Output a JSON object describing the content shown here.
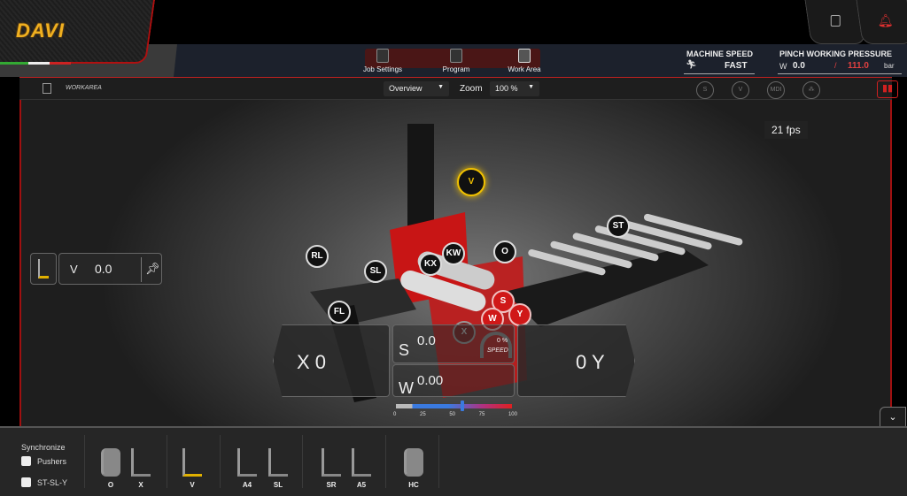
{
  "brand": {
    "logo": "DAVI"
  },
  "nav": {
    "tabs": [
      {
        "label": "Job Settings"
      },
      {
        "label": "Program"
      },
      {
        "label": "Work Area"
      }
    ],
    "active": "Work Area"
  },
  "status": {
    "machine_speed": {
      "label": "MACHINE SPEED",
      "value": "FAST"
    },
    "pinch_pressure": {
      "label": "PINCH WORKING PRESSURE",
      "axis": "W",
      "current": "0.0",
      "sep": "/",
      "setpoint": "111.0",
      "unit": "bar"
    }
  },
  "toolbar": {
    "title": "WORKAREA",
    "view": "Overview",
    "zoom_label": "Zoom",
    "zoom": "100 %",
    "icons": [
      "s-axis-icon",
      "v-axis-icon",
      "mdi-icon",
      "cluster-icon",
      "chart-icon"
    ],
    "mdi": "MDI"
  },
  "viewport": {
    "fps": "21 fps",
    "markers": [
      "V",
      "ST",
      "RL",
      "SL",
      "KX",
      "KW",
      "O",
      "FL",
      "S",
      "W",
      "Y",
      "X"
    ],
    "v_panel": {
      "axis": "V",
      "value": "0.0"
    },
    "x_panel": {
      "text": "X 0"
    },
    "y_panel": {
      "text": "0 Y"
    },
    "s_panel": {
      "axis": "S",
      "value": "0.0"
    },
    "w_panel": {
      "axis": "W",
      "value": "0.00"
    },
    "speed_gauge": {
      "value": "0 %",
      "label": "SPEED"
    },
    "scale": {
      "ticks": [
        "0",
        "25",
        "50",
        "75",
        "100"
      ],
      "indicator_percent": 57
    }
  },
  "bottom": {
    "sync_label": "Synchronize",
    "checkboxes": [
      {
        "label": "Pushers",
        "checked": false
      },
      {
        "label": "ST-SL-Y",
        "checked": false
      }
    ],
    "tools": [
      "O",
      "X",
      "V",
      "A4",
      "SL",
      "SR",
      "A5",
      "HC"
    ]
  },
  "colors": {
    "accent": "#c01818",
    "logo": "#f0b020",
    "active_marker": "#f0c000"
  }
}
